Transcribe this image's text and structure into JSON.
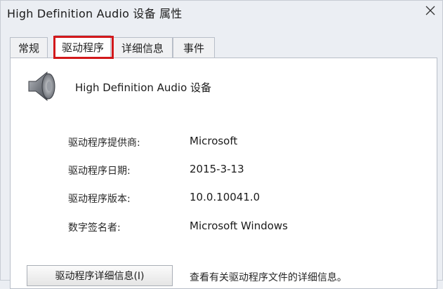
{
  "window": {
    "title": "High Definition Audio 设备 属性"
  },
  "tabs": [
    {
      "label": "常规",
      "active": false
    },
    {
      "label": "驱动程序",
      "active": true
    },
    {
      "label": "详细信息",
      "active": false
    },
    {
      "label": "事件",
      "active": false
    }
  ],
  "device": {
    "icon": "speaker-icon",
    "name": "High Definition Audio 设备"
  },
  "driver_info": [
    {
      "label": "驱动程序提供商:",
      "value": "Microsoft"
    },
    {
      "label": "驱动程序日期:",
      "value": "2015-3-13"
    },
    {
      "label": "驱动程序版本:",
      "value": "10.0.10041.0"
    },
    {
      "label": "数字签名者:",
      "value": "Microsoft Windows"
    }
  ],
  "details": {
    "button_label": "驱动程序详细信息(I)",
    "description": "查看有关驱动程序文件的详细信息。"
  },
  "colors": {
    "highlight": "#d2181b",
    "background": "#ebeef3"
  }
}
